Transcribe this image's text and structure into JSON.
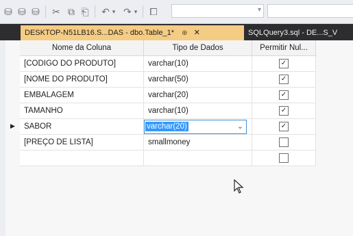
{
  "toolbar": {
    "combo_text": "",
    "combo2_text": ""
  },
  "tabs": {
    "active": {
      "label": "DESKTOP-N51LB16.S...DAS - dbo.Table_1*",
      "pin": "⊕",
      "close": "✕"
    },
    "inactive": {
      "label": "SQLQuery3.sql - DE...S_V"
    }
  },
  "grid": {
    "headers": [
      "Nome da Coluna",
      "Tipo de Dados",
      "Permitir Nul..."
    ],
    "rows": [
      {
        "name": "[CODIGO DO PRODUTO]",
        "type": "varchar(10)",
        "allow_nulls": true
      },
      {
        "name": "[NOME DO PRODUTO]",
        "type": "varchar(50)",
        "allow_nulls": true
      },
      {
        "name": "EMBALAGEM",
        "type": "varchar(20)",
        "allow_nulls": true
      },
      {
        "name": "TAMANHO",
        "type": "varchar(10)",
        "allow_nulls": true
      },
      {
        "name": "SABOR",
        "type": "varchar(20)",
        "allow_nulls": true,
        "current": true,
        "editing": true
      },
      {
        "name": "[PREÇO DE LISTA]",
        "type": "smallmoney",
        "allow_nulls": false
      },
      {
        "name": "",
        "type": "",
        "allow_nulls": false
      }
    ],
    "row_marker": "▶"
  }
}
